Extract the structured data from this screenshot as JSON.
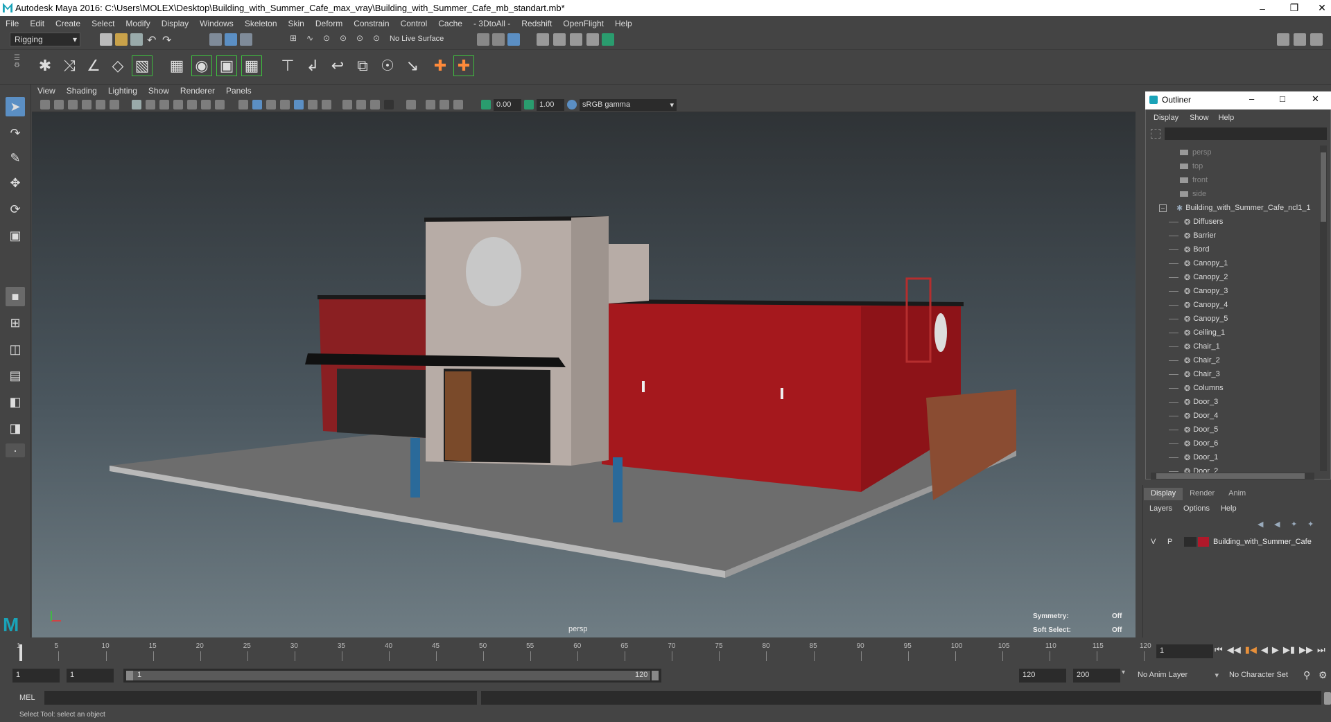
{
  "window": {
    "title": "Autodesk Maya 2016: C:\\Users\\MOLEX\\Desktop\\Building_with_Summer_Cafe_max_vray\\Building_with_Summer_Cafe_mb_standart.mb*"
  },
  "menu": [
    "File",
    "Edit",
    "Create",
    "Select",
    "Modify",
    "Display",
    "Windows",
    "Skeleton",
    "Skin",
    "Deform",
    "Constrain",
    "Control",
    "Cache",
    "- 3DtoAll -",
    "Redshift",
    "OpenFlight",
    "Help"
  ],
  "statusline": {
    "mode": "Rigging",
    "live_surface": "No Live Surface"
  },
  "viewport": {
    "menu": [
      "View",
      "Shading",
      "Lighting",
      "Show",
      "Renderer",
      "Panels"
    ],
    "near": "0.00",
    "far": "1.00",
    "color_space": "sRGB gamma",
    "camera_label": "persp",
    "symmetry_label": "Symmetry:",
    "symmetry_value": "Off",
    "soft_select_label": "Soft Select:",
    "soft_select_value": "Off"
  },
  "outliner": {
    "title": "Outliner",
    "menu": [
      "Display",
      "Show",
      "Help"
    ],
    "cameras": [
      "persp",
      "top",
      "front",
      "side"
    ],
    "root": "Building_with_Summer_Cafe_ncl1_1",
    "children": [
      "Diffusers",
      "Barrier",
      "Bord",
      "Canopy_1",
      "Canopy_2",
      "Canopy_3",
      "Canopy_4",
      "Canopy_5",
      "Ceiling_1",
      "Chair_1",
      "Chair_2",
      "Chair_3",
      "Columns",
      "Door_3",
      "Door_4",
      "Door_5",
      "Door_6",
      "Door_1",
      "Door_2"
    ]
  },
  "layers": {
    "tabs": [
      "Display",
      "Render",
      "Anim"
    ],
    "menu": [
      "Layers",
      "Options",
      "Help"
    ],
    "row": {
      "v": "V",
      "p": "P",
      "name": "Building_with_Summer_Cafe",
      "color": "#b0182a"
    }
  },
  "timeline": {
    "ticks": [
      "1",
      "5",
      "10",
      "15",
      "20",
      "25",
      "30",
      "35",
      "40",
      "45",
      "50",
      "55",
      "60",
      "65",
      "70",
      "75",
      "80",
      "85",
      "90",
      "95",
      "100",
      "105",
      "110",
      "115",
      "120"
    ],
    "current_frame": "1"
  },
  "range": {
    "start": "1",
    "start_inner": "1",
    "slider_start": "1",
    "slider_end": "120",
    "end_inner": "120",
    "end": "200",
    "anim_layer": "No Anim Layer",
    "char_set": "No Character Set"
  },
  "cmd": {
    "label": "MEL"
  },
  "help": {
    "text": "Select Tool: select an object"
  }
}
